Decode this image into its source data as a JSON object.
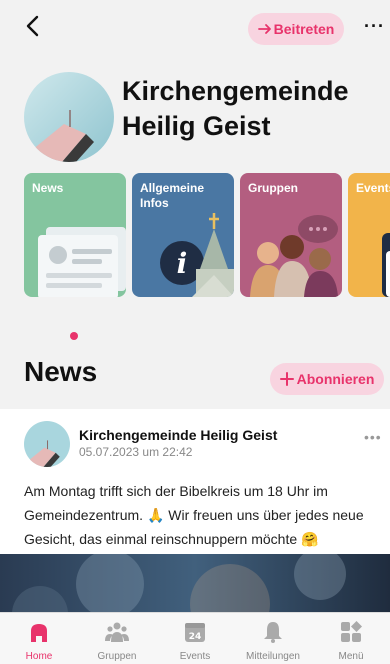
{
  "header": {
    "join_label": "Beitreten",
    "title": "Kirchengemeinde Heilig Geist"
  },
  "categories": [
    {
      "label": "News"
    },
    {
      "label": "Allgemeine Infos"
    },
    {
      "label": "Gruppen"
    },
    {
      "label": "Events"
    }
  ],
  "news": {
    "heading": "News",
    "subscribe_label": "Abonnieren"
  },
  "post": {
    "author": "Kirchengemeinde Heilig Geist",
    "date": "05.07.2023 um 22:42",
    "text": "Am Montag trifft sich der Bibelkreis um 18 Uhr im Gemeindezentrum. 🙏 Wir freuen uns über jedes neue Gesicht, das einmal reinschnuppern möchte 🤗"
  },
  "tabbar": {
    "tabs": [
      {
        "label": "Home",
        "icon": "home-icon",
        "active": true
      },
      {
        "label": "Gruppen",
        "icon": "people-icon",
        "active": false
      },
      {
        "label": "Events",
        "icon": "calendar-icon",
        "calendar_day": "24",
        "active": false
      },
      {
        "label": "Mitteilungen",
        "icon": "bell-icon",
        "active": false
      },
      {
        "label": "Menü",
        "icon": "menu-grid-icon",
        "active": false
      }
    ]
  },
  "colors": {
    "accent": "#e8336b",
    "accent_light": "#f8d4e0"
  }
}
